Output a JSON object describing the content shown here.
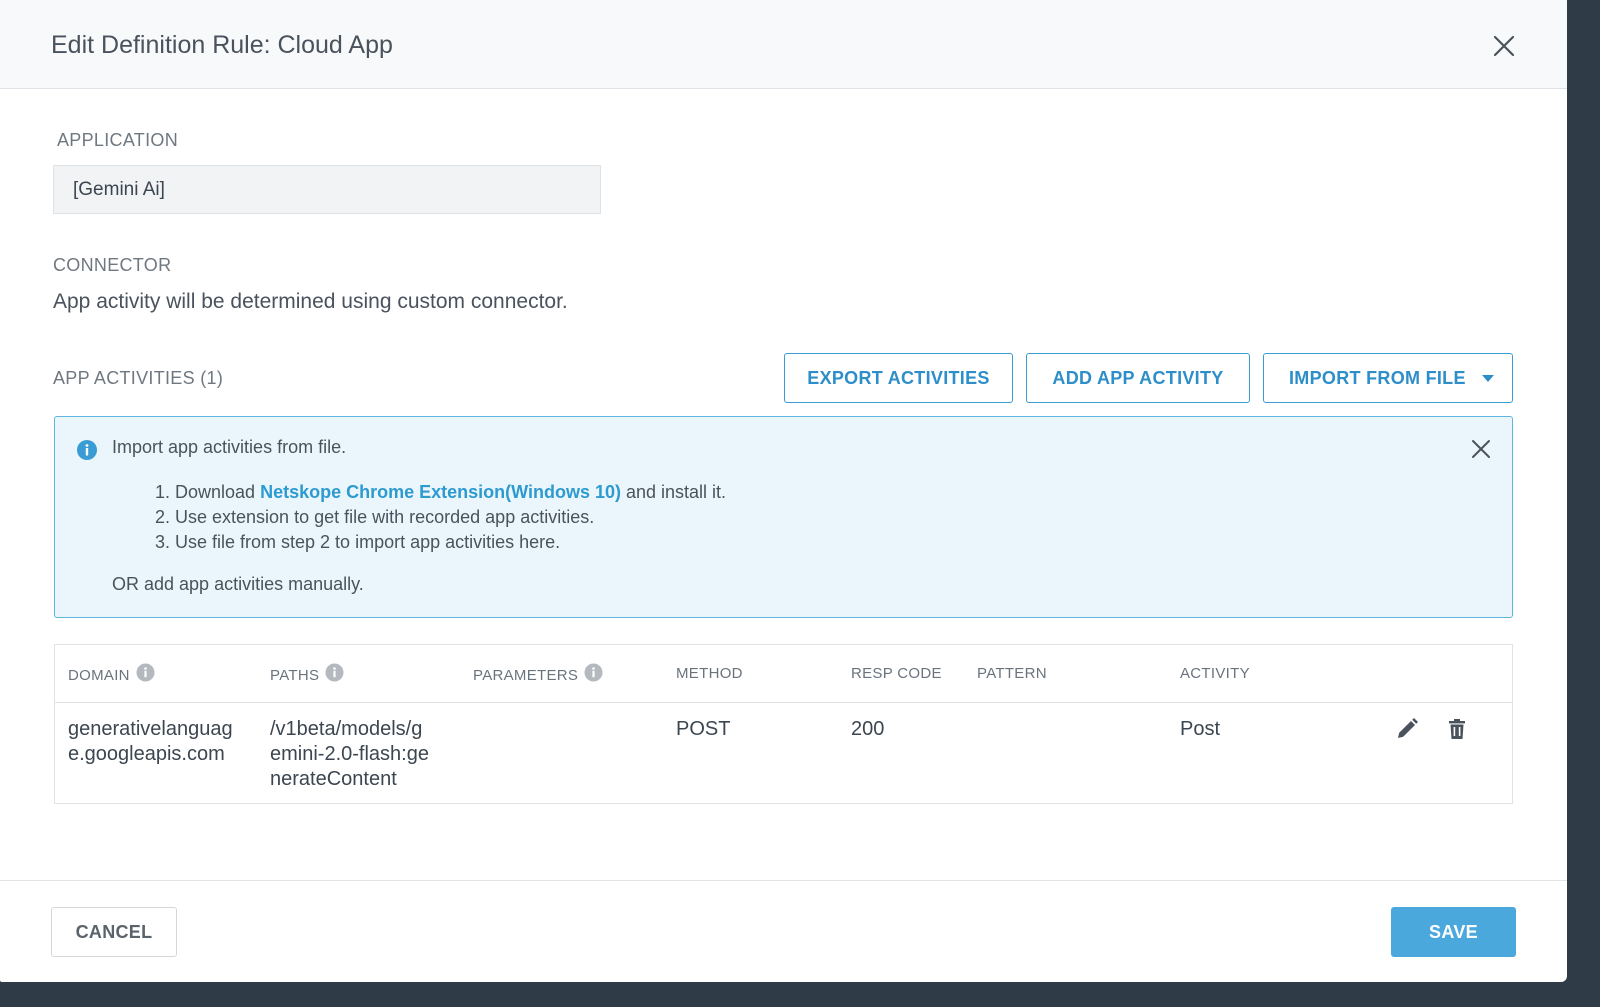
{
  "dialog": {
    "title": "Edit Definition Rule: Cloud App"
  },
  "application": {
    "label": "APPLICATION",
    "value": "[Gemini Ai]"
  },
  "connector": {
    "label": "CONNECTOR",
    "description": "App activity will be determined using custom connector."
  },
  "activities": {
    "label": "APP ACTIVITIES (1)",
    "export_label": "EXPORT ACTIVITIES",
    "add_label": "ADD APP ACTIVITY",
    "import_label": "IMPORT FROM FILE"
  },
  "info": {
    "heading": "Import app activities from file.",
    "step1_num": "1.",
    "step1_prefix": "Download",
    "step1_link": "Netskope Chrome Extension(Windows 10)",
    "step1_suffix": "and install it.",
    "step2_num": "2.",
    "step2": "Use extension to get file with recorded app activities.",
    "step3_num": "3.",
    "step3": "Use file from step 2 to import app activities here.",
    "or_text": "OR add app activities manually."
  },
  "table": {
    "columns": {
      "domain": "DOMAIN",
      "paths": "PATHS",
      "parameters": "PARAMETERS",
      "method": "METHOD",
      "resp_code": "RESP CODE",
      "pattern": "PATTERN",
      "activity": "ACTIVITY"
    },
    "rows": [
      {
        "domain_l1": "generativelanguag",
        "domain_l2": "e.googleapis.com",
        "path_l1": "/v1beta/models/g",
        "path_l2": "emini-2.0-flash:ge",
        "path_l3": "nerateContent",
        "parameters": "",
        "method": "POST",
        "resp_code": "200",
        "pattern": "",
        "activity": "Post"
      }
    ]
  },
  "footer": {
    "cancel_label": "CANCEL",
    "save_label": "SAVE"
  },
  "colors": {
    "accent": "#3a9cd4",
    "save_bg": "#4aa8dc",
    "info_bg": "#eaf6fb",
    "info_border": "#5cb6dd",
    "backdrop": "#2f3b47"
  },
  "icons": {
    "close": "close-icon",
    "info": "info-circle-icon",
    "hint": "info-hint-icon",
    "edit": "pencil-icon",
    "delete": "trash-icon",
    "caret": "caret-down-icon"
  }
}
